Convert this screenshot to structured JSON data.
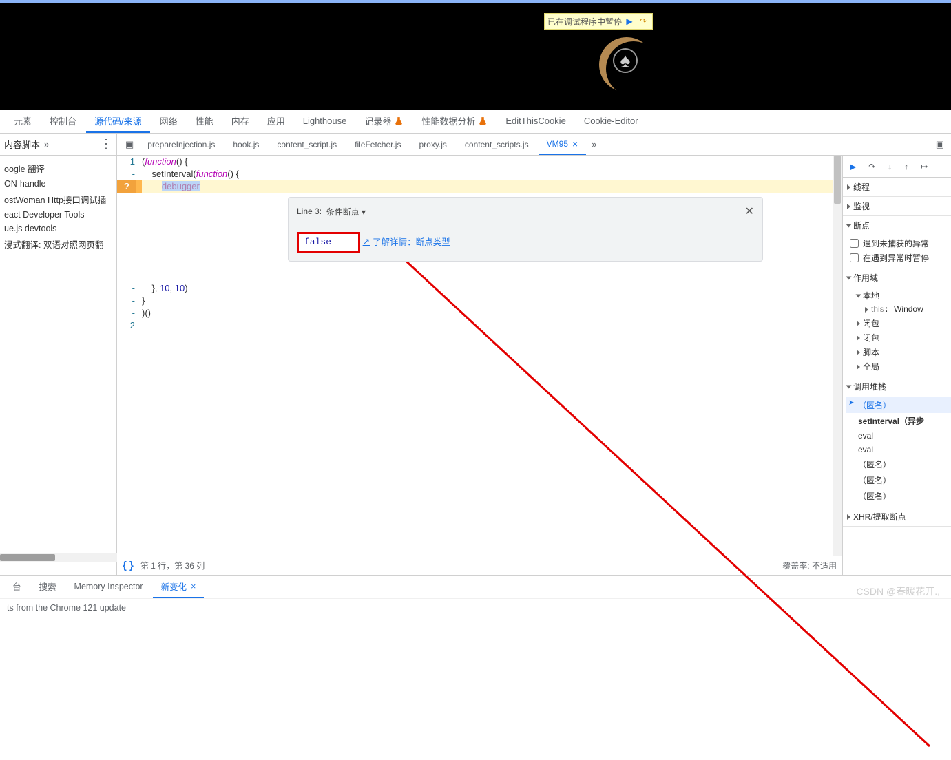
{
  "pause_bar": {
    "text": "已在调试程序中暂停"
  },
  "devtools_tabs": {
    "items": [
      "元素",
      "控制台",
      "源代码/来源",
      "网络",
      "性能",
      "内存",
      "应用",
      "Lighthouse",
      "记录器",
      "性能数据分析",
      "EditThisCookie",
      "Cookie-Editor"
    ],
    "active_index": 2
  },
  "left_head": {
    "label": "内容脚本",
    "more": "»"
  },
  "file_tabs": {
    "left_icon": "show-navigator",
    "items": [
      "prepareInjection.js",
      "hook.js",
      "content_script.js",
      "fileFetcher.js",
      "proxy.js",
      "content_scripts.js",
      "VM95"
    ],
    "active_index": 6,
    "more": "»"
  },
  "sidebar": {
    "items": [
      "oogle 翻译",
      "ON-handle",
      "ostWoman Http接口调试插",
      "eact Developer Tools",
      "ue.js devtools",
      "浸式翻译: 双语对照网页翻"
    ]
  },
  "code": {
    "lines": [
      {
        "n": "1",
        "t": "(function() {",
        "kind": "fn"
      },
      {
        "n": "-",
        "t": "    setInterval(function() {",
        "kind": "fn2"
      },
      {
        "n": "-",
        "t": "        debugger",
        "kind": "dbg",
        "hl": true
      },
      {
        "n": "",
        "t": "",
        "kind": "pop"
      },
      {
        "n": "-",
        "t": "    }, 10, 10)",
        "kind": "nums"
      },
      {
        "n": "-",
        "t": "}",
        "kind": "plain"
      },
      {
        "n": "-",
        "t": ")()",
        "kind": "plain"
      },
      {
        "n": "2",
        "t": "",
        "kind": "plain"
      }
    ]
  },
  "bp_popover": {
    "line_label": "Line 3:",
    "type_label": "条件断点 ▾",
    "input_value": "false",
    "link_text": "了解详情：断点类型"
  },
  "ed_footer": {
    "pos": "第 1 行，第 36 列",
    "coverage_label": "覆盖率:",
    "coverage_value": "不适用"
  },
  "right": {
    "sections": {
      "threads": "线程",
      "watch": "监视",
      "breakpoints": "断点",
      "bp_opt1": "遇到未捕获的异常",
      "bp_opt2": "在遇到异常时暂停",
      "scope": "作用域",
      "local": "本地",
      "this_label": "this",
      "this_value": "Window",
      "closure": "闭包",
      "closure2": "闭包",
      "script": "脚本",
      "global": "全局",
      "callstack": "调用堆栈",
      "frames": [
        "（匿名）",
        "setInterval（异步",
        "eval",
        "eval",
        "（匿名）",
        "（匿名）",
        "（匿名）"
      ],
      "xhr": "XHR/提取断点"
    }
  },
  "drawer": {
    "tabs": [
      "台",
      "搜索",
      "Memory Inspector",
      "新变化"
    ],
    "active_index": 3
  },
  "whatsnew": "ts from the Chrome 121 update",
  "watermark": "CSDN @春暖花开.,"
}
